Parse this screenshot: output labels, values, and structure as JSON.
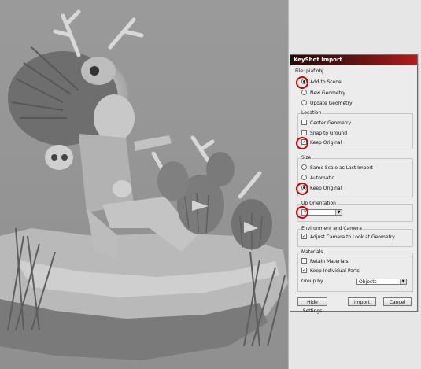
{
  "dialog": {
    "title": "KeyShot Import",
    "file_line": "File: piaf.obj",
    "add_to_scene": "Add to Scene",
    "new_geometry": "New Geometry",
    "update_geometry": "Update Geometry",
    "location": {
      "title": "Location",
      "center_geometry": "Center Geometry",
      "snap_to_ground": "Snap to Ground",
      "keep_original": "Keep Original"
    },
    "size": {
      "title": "Size",
      "same_scale": "Same Scale as Last Import",
      "automatic": "Automatic",
      "keep_original": "Keep Original"
    },
    "up_orientation": {
      "title": "Up Orientation",
      "value": "Y"
    },
    "env_camera": {
      "title": "Environment and Camera",
      "adjust_camera": "Adjust Camera to Look at Geometry"
    },
    "materials": {
      "title": "Materials",
      "retain_materials": "Retain Materials",
      "keep_individual_parts": "Keep Individual Parts",
      "group_by_label": "Group by",
      "group_by_value": "Objects"
    },
    "buttons": {
      "hide_settings": "Hide Settings",
      "import": "Import",
      "cancel": "Cancel"
    }
  },
  "colors": {
    "title_bar_start": "#260a0a",
    "title_bar_end": "#b21c1c",
    "highlight_circle": "#d00000"
  }
}
